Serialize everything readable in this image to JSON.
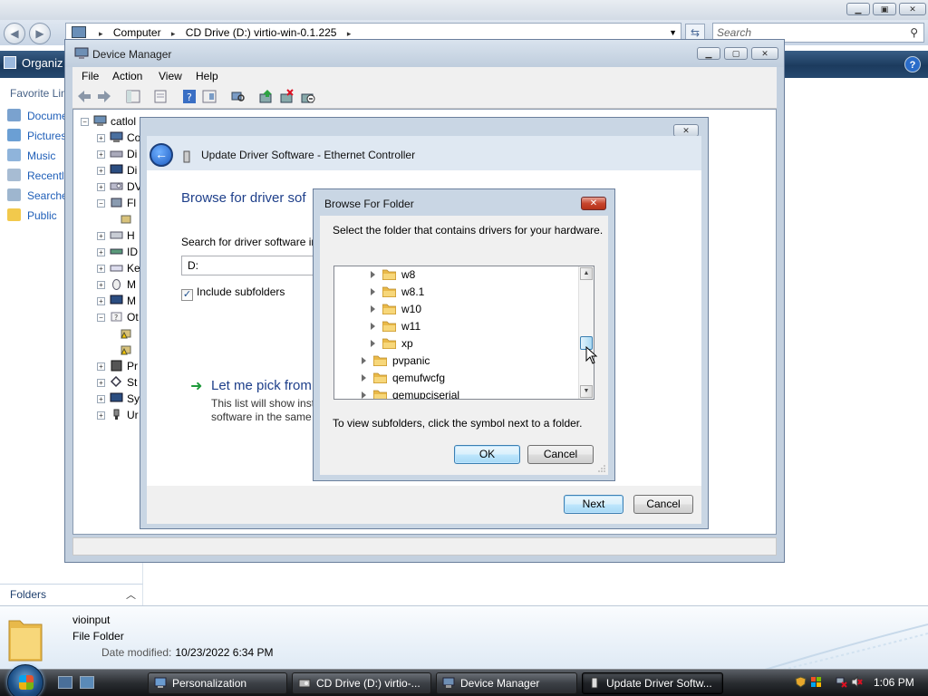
{
  "explorer": {
    "address_parts": [
      "Computer",
      "CD Drive (D:) virtio-win-0.1.225"
    ],
    "search_placeholder": "Search",
    "organize_label": "Organiz",
    "favorite_links_heading": "Favorite Lin",
    "favorites": [
      {
        "label": "Docume",
        "icon": "documents-icon"
      },
      {
        "label": "Pictures",
        "icon": "pictures-icon"
      },
      {
        "label": "Music",
        "icon": "music-icon"
      },
      {
        "label": "Recently",
        "icon": "recently-changed-icon"
      },
      {
        "label": "Searche",
        "icon": "searches-icon"
      },
      {
        "label": "Public",
        "icon": "public-folder-icon"
      }
    ],
    "folders_label": "Folders",
    "details": {
      "name": "vioinput",
      "type": "File Folder",
      "date_label": "Date modified:",
      "date_value": "10/23/2022 6:34 PM"
    }
  },
  "device_manager": {
    "title": "Device Manager",
    "menu": [
      "File",
      "Action",
      "View",
      "Help"
    ],
    "tree": {
      "root": "catlol",
      "items": [
        "Co",
        "Di",
        "Di",
        "DV",
        "Fl",
        "",
        "H",
        "ID",
        "Ke",
        "M",
        "M",
        "Ot",
        "",
        "",
        "Pr",
        "St",
        "Sy",
        "Ur"
      ]
    }
  },
  "update_driver": {
    "title": "Update Driver Software - Ethernet Controller",
    "heading": "Browse for driver sof",
    "search_label": "Search for driver software in",
    "path_value": "D:",
    "include_subfolders_label": "Include subfolders",
    "include_subfolders_checked": true,
    "pick_link": "Let me pick from",
    "pick_desc_line1": "This list will show inst",
    "pick_desc_line2": "software in the same",
    "next_label": "Next",
    "cancel_label": "Cancel"
  },
  "browse_folder": {
    "title": "Browse For Folder",
    "instruction": "Select the folder that contains drivers for your hardware.",
    "folders": [
      {
        "name": "w8",
        "level": 2
      },
      {
        "name": "w8.1",
        "level": 2
      },
      {
        "name": "w10",
        "level": 2
      },
      {
        "name": "w11",
        "level": 2
      },
      {
        "name": "xp",
        "level": 2
      },
      {
        "name": "pvpanic",
        "level": 1
      },
      {
        "name": "qemufwcfg",
        "level": 1
      },
      {
        "name": "qemupciserial",
        "level": 1
      }
    ],
    "hint": "To view subfolders, click the symbol next to a folder.",
    "ok_label": "OK",
    "cancel_label": "Cancel"
  },
  "taskbar": {
    "tasks": [
      {
        "label": "Personalization",
        "active": false
      },
      {
        "label": "CD Drive (D:) virtio-...",
        "active": false
      },
      {
        "label": "Device Manager",
        "active": false
      },
      {
        "label": "Update Driver Softw...",
        "active": true
      }
    ],
    "clock": "1:06 PM"
  },
  "colors": {
    "link_blue": "#1e3f8a",
    "folder_yellow": "#f2c94c",
    "toolbar_dark_blue": "#1c3b5e"
  }
}
